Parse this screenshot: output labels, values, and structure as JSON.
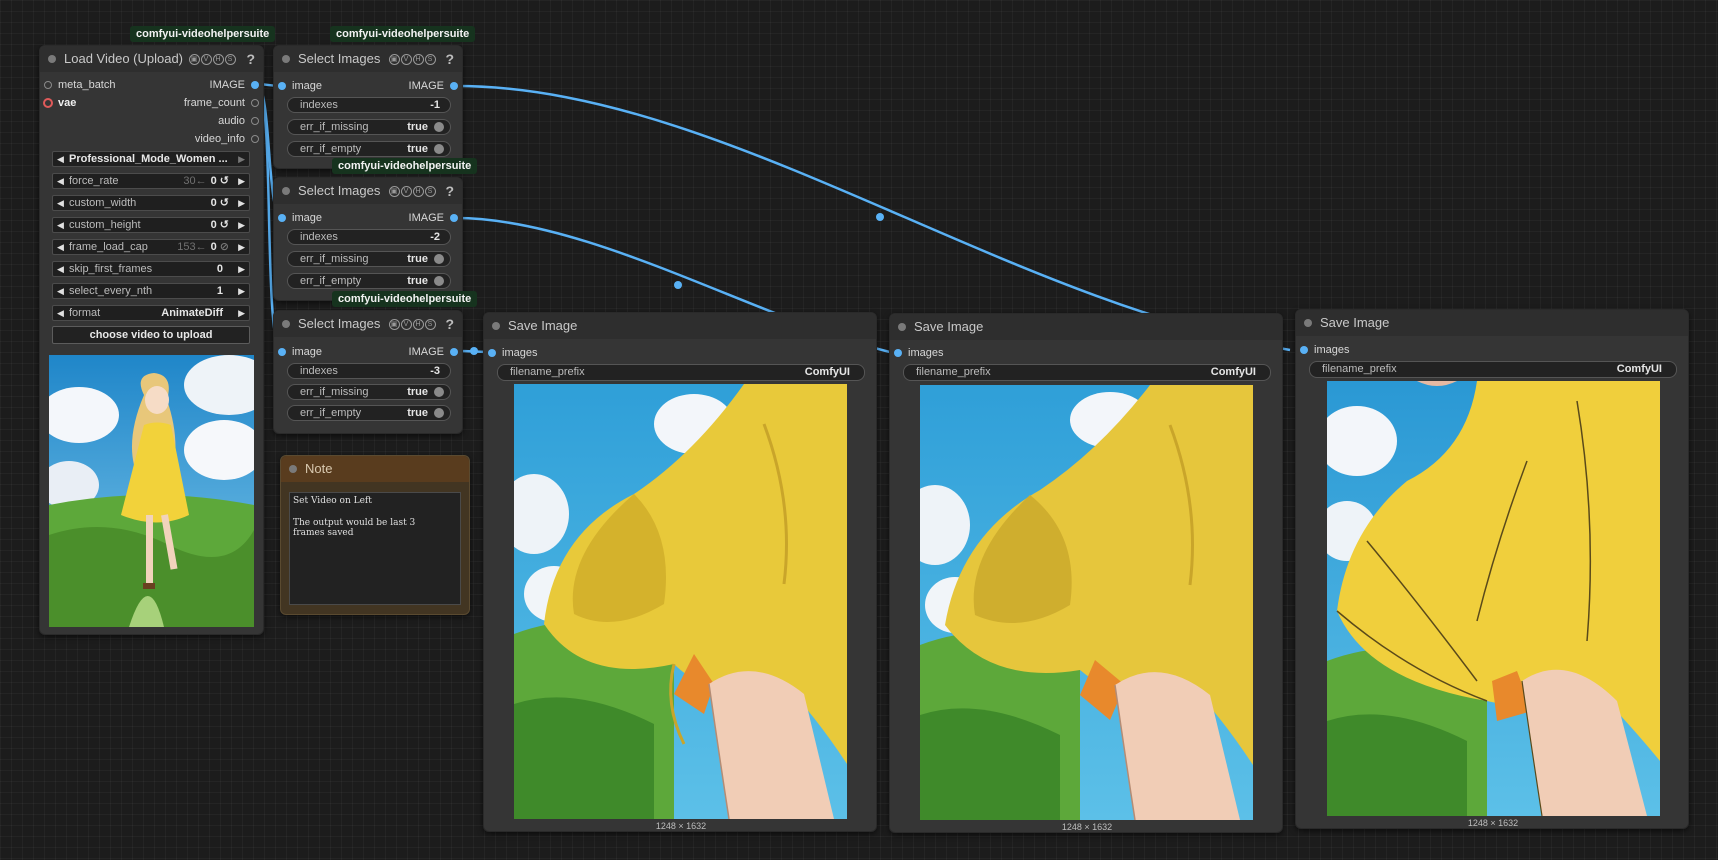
{
  "badges": {
    "load_video": "comfyui-videohelpersuite",
    "select1": "comfyui-videohelpersuite",
    "select2": "comfyui-videohelpersuite",
    "select3": "comfyui-videohelpersuite"
  },
  "load_video": {
    "title": "Load Video (Upload)",
    "help": "?",
    "inputs": [
      "meta_batch",
      "vae"
    ],
    "outputs": [
      "IMAGE",
      "frame_count",
      "audio",
      "video_info"
    ],
    "video_select": "Professional_Mode_Women ...",
    "widgets": [
      {
        "label": "force_rate",
        "hint": "30←",
        "value": "0"
      },
      {
        "label": "custom_width",
        "hint": "",
        "value": "0"
      },
      {
        "label": "custom_height",
        "hint": "",
        "value": "0"
      },
      {
        "label": "frame_load_cap",
        "hint": "153←",
        "value": "0"
      },
      {
        "label": "skip_first_frames",
        "hint": "",
        "value": "0"
      },
      {
        "label": "select_every_nth",
        "hint": "",
        "value": "1"
      },
      {
        "label": "format",
        "hint": "",
        "value": "AnimateDiff"
      }
    ],
    "upload_button": "choose video to upload"
  },
  "select_images": [
    {
      "title": "Select Images",
      "input": "image",
      "output": "IMAGE",
      "indexes_label": "indexes",
      "indexes": "-1",
      "err_if_missing_label": "err_if_missing",
      "err_if_missing": "true",
      "err_if_empty_label": "err_if_empty",
      "err_if_empty": "true"
    },
    {
      "title": "Select Images",
      "input": "image",
      "output": "IMAGE",
      "indexes_label": "indexes",
      "indexes": "-2",
      "err_if_missing_label": "err_if_missing",
      "err_if_missing": "true",
      "err_if_empty_label": "err_if_empty",
      "err_if_empty": "true"
    },
    {
      "title": "Select Images",
      "input": "image",
      "output": "IMAGE",
      "indexes_label": "indexes",
      "indexes": "-3",
      "err_if_missing_label": "err_if_missing",
      "err_if_missing": "true",
      "err_if_empty_label": "err_if_empty",
      "err_if_empty": "true"
    }
  ],
  "note": {
    "title": "Note",
    "text": "Set Video on Left\n\nThe output would be last 3\nframes saved"
  },
  "save_images": [
    {
      "title": "Save Image",
      "input": "images",
      "prefix_label": "filename_prefix",
      "prefix": "ComfyUI",
      "dims": "1248 × 1632"
    },
    {
      "title": "Save Image",
      "input": "images",
      "prefix_label": "filename_prefix",
      "prefix": "ComfyUI",
      "dims": "1248 × 1632"
    },
    {
      "title": "Save Image",
      "input": "images",
      "prefix_label": "filename_prefix",
      "prefix": "ComfyUI",
      "dims": "1248 × 1632"
    }
  ],
  "vhs_icons": [
    "V",
    "H",
    "S"
  ],
  "colors": {
    "link": "#59b1f5",
    "canvas": "#1c1c1c",
    "node_bg": "#353535",
    "badge_bg": "#16331e",
    "note_title": "#593c1e",
    "dress_yellow": "#f2d23a",
    "sky_blue": "#2f9fd8",
    "grass_green": "#5da83a"
  }
}
